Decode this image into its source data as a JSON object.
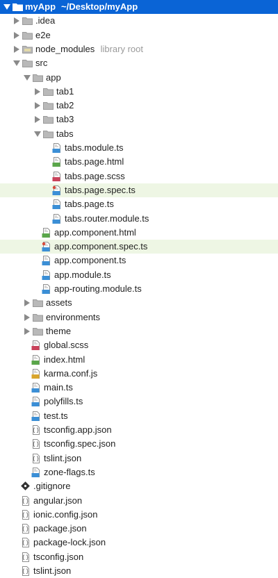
{
  "tree": {
    "root": {
      "name": "myApp",
      "path": "~/Desktop/myApp"
    },
    "items": [
      {
        "name": ".idea",
        "depth": 1,
        "type": "folder",
        "expanded": false
      },
      {
        "name": "e2e",
        "depth": 1,
        "type": "folder",
        "expanded": false
      },
      {
        "name": "node_modules",
        "depth": 1,
        "type": "folder",
        "expanded": false,
        "note": "library root",
        "folder_style": "lib"
      },
      {
        "name": "src",
        "depth": 1,
        "type": "folder",
        "expanded": true
      },
      {
        "name": "app",
        "depth": 2,
        "type": "folder",
        "expanded": true
      },
      {
        "name": "tab1",
        "depth": 3,
        "type": "folder",
        "expanded": false
      },
      {
        "name": "tab2",
        "depth": 3,
        "type": "folder",
        "expanded": false
      },
      {
        "name": "tab3",
        "depth": 3,
        "type": "folder",
        "expanded": false
      },
      {
        "name": "tabs",
        "depth": 3,
        "type": "folder",
        "expanded": true
      },
      {
        "name": "tabs.module.ts",
        "depth": 4,
        "type": "file",
        "icon": "ts"
      },
      {
        "name": "tabs.page.html",
        "depth": 4,
        "type": "file",
        "icon": "html"
      },
      {
        "name": "tabs.page.scss",
        "depth": 4,
        "type": "file",
        "icon": "sass"
      },
      {
        "name": "tabs.page.spec.ts",
        "depth": 4,
        "type": "file",
        "icon": "spec",
        "highlight": true
      },
      {
        "name": "tabs.page.ts",
        "depth": 4,
        "type": "file",
        "icon": "ts"
      },
      {
        "name": "tabs.router.module.ts",
        "depth": 4,
        "type": "file",
        "icon": "ts"
      },
      {
        "name": "app.component.html",
        "depth": 3,
        "type": "file",
        "icon": "html"
      },
      {
        "name": "app.component.spec.ts",
        "depth": 3,
        "type": "file",
        "icon": "spec",
        "highlight": true
      },
      {
        "name": "app.component.ts",
        "depth": 3,
        "type": "file",
        "icon": "ts"
      },
      {
        "name": "app.module.ts",
        "depth": 3,
        "type": "file",
        "icon": "ts"
      },
      {
        "name": "app-routing.module.ts",
        "depth": 3,
        "type": "file",
        "icon": "ts"
      },
      {
        "name": "assets",
        "depth": 2,
        "type": "folder",
        "expanded": false
      },
      {
        "name": "environments",
        "depth": 2,
        "type": "folder",
        "expanded": false
      },
      {
        "name": "theme",
        "depth": 2,
        "type": "folder",
        "expanded": false
      },
      {
        "name": "global.scss",
        "depth": 2,
        "type": "file",
        "icon": "sass"
      },
      {
        "name": "index.html",
        "depth": 2,
        "type": "file",
        "icon": "html"
      },
      {
        "name": "karma.conf.js",
        "depth": 2,
        "type": "file",
        "icon": "js"
      },
      {
        "name": "main.ts",
        "depth": 2,
        "type": "file",
        "icon": "ts"
      },
      {
        "name": "polyfills.ts",
        "depth": 2,
        "type": "file",
        "icon": "ts"
      },
      {
        "name": "test.ts",
        "depth": 2,
        "type": "file",
        "icon": "ts"
      },
      {
        "name": "tsconfig.app.json",
        "depth": 2,
        "type": "file",
        "icon": "json"
      },
      {
        "name": "tsconfig.spec.json",
        "depth": 2,
        "type": "file",
        "icon": "json"
      },
      {
        "name": "tslint.json",
        "depth": 2,
        "type": "file",
        "icon": "json"
      },
      {
        "name": "zone-flags.ts",
        "depth": 2,
        "type": "file",
        "icon": "ts"
      },
      {
        "name": ".gitignore",
        "depth": 1,
        "type": "file",
        "icon": "git"
      },
      {
        "name": "angular.json",
        "depth": 1,
        "type": "file",
        "icon": "json"
      },
      {
        "name": "ionic.config.json",
        "depth": 1,
        "type": "file",
        "icon": "json"
      },
      {
        "name": "package.json",
        "depth": 1,
        "type": "file",
        "icon": "json"
      },
      {
        "name": "package-lock.json",
        "depth": 1,
        "type": "file",
        "icon": "json"
      },
      {
        "name": "tsconfig.json",
        "depth": 1,
        "type": "file",
        "icon": "json"
      },
      {
        "name": "tslint.json",
        "depth": 1,
        "type": "file",
        "icon": "json"
      }
    ]
  },
  "colors": {
    "selection": "#0a64d6",
    "highlight": "#eef6e4",
    "folder": "#a7a7a7",
    "ts": "#3b8fd6",
    "html": "#5aa64a",
    "sass": "#c9425b",
    "js": "#d9a52c",
    "spec": "#5aa64a"
  }
}
